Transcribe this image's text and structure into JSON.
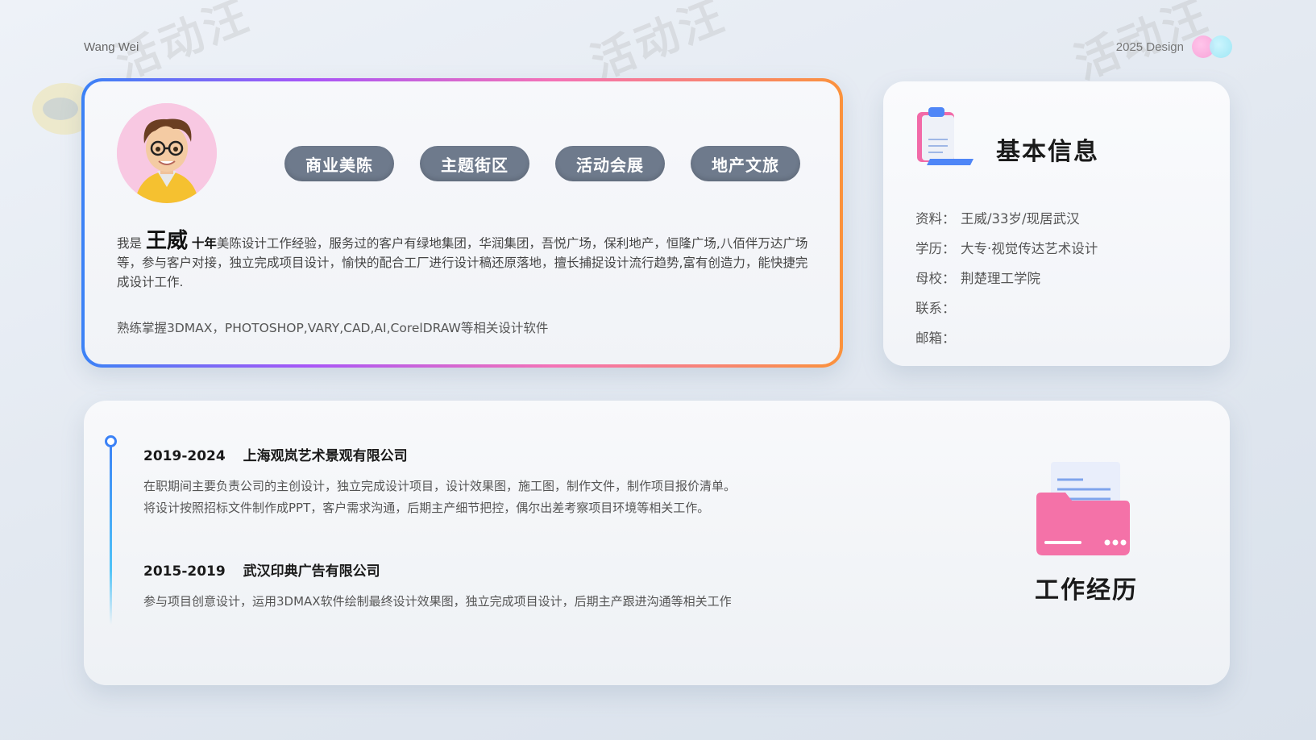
{
  "header": {
    "name": "Wang Wei",
    "design_label": "2025 Design"
  },
  "profile": {
    "tags": [
      "商业美陈",
      "主题街区",
      "活动会展",
      "地产文旅"
    ],
    "intro_prefix": "我是",
    "name": "王威",
    "years": "十年",
    "intro_body": "美陈设计工作经验，服务过的客户有绿地集团，华润集团，吾悦广场，保利地产，恒隆广场,八佰伴万达广场等，参与客户对接，独立完成项目设计，愉快的配合工厂进行设计稿还原落地，擅长捕捉设计流行趋势,富有创造力，能快捷完成设计工作.",
    "skills": "熟练掌握3DMAX，PHOTOSHOP,VARY,CAD,AI,CorelDRAW等相关设计软件"
  },
  "info": {
    "title": "基本信息",
    "rows": [
      {
        "key": "资料：",
        "value": "王威/33岁/现居武汉"
      },
      {
        "key": "学历：",
        "value": "大专·视觉传达艺术设计"
      },
      {
        "key": "母校：",
        "value": "荆楚理工学院"
      },
      {
        "key": "联系：",
        "value": ""
      },
      {
        "key": "邮箱：",
        "value": ""
      }
    ]
  },
  "experience": {
    "title": "工作经历",
    "jobs": [
      {
        "period": "2019-2024",
        "company": "上海观岚艺术景观有限公司",
        "desc": [
          "在职期间主要负责公司的主创设计，独立完成设计项目，设计效果图，施工图，制作文件，制作项目报价清单。",
          "将设计按照招标文件制作成PPT，客户需求沟通，后期主产细节把控，偶尔出差考察项目环境等相关工作。"
        ]
      },
      {
        "period": "2015-2019",
        "company": "武汉印典广告有限公司",
        "desc": [
          "参与项目创意设计，运用3DMAX软件绘制最终设计效果图，独立完成项目设计，后期主产跟进沟通等相关工作"
        ]
      }
    ]
  },
  "watermark": {
    "text": "活动汪"
  },
  "colors": {
    "frame_gradient": [
      "#3b82f6",
      "#a855f7",
      "#f472b6",
      "#fb923c"
    ],
    "tag_bg": "#6e7a8c",
    "timeline": "#3b82f6"
  }
}
